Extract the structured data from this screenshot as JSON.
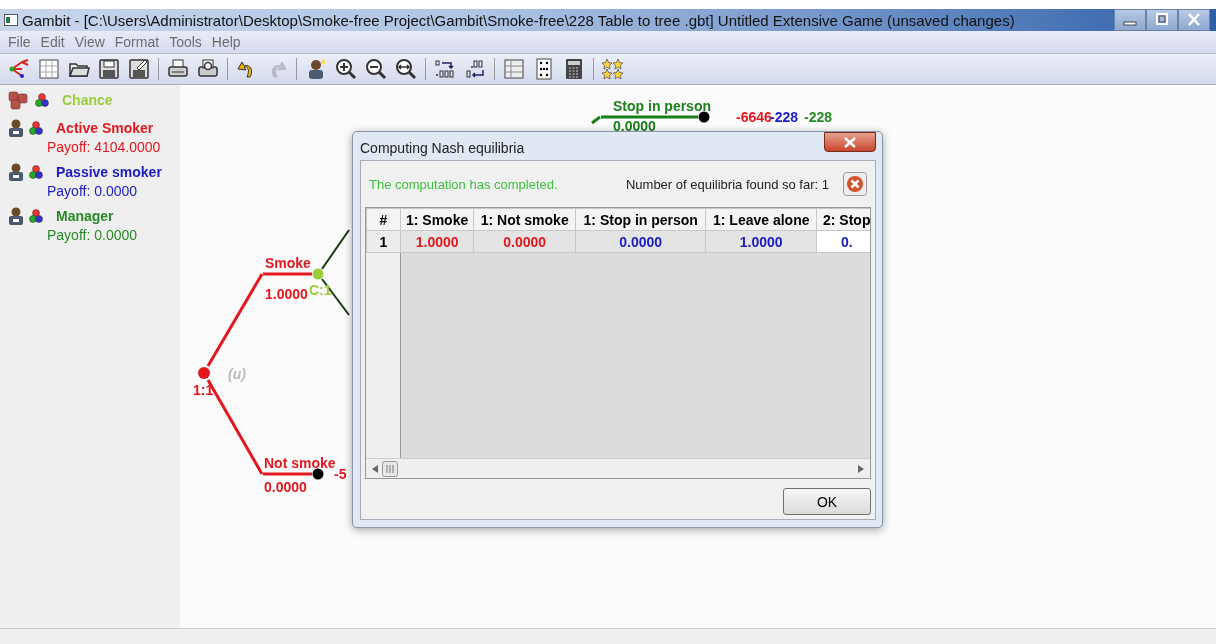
{
  "window": {
    "title": "Gambit - [C:\\Users\\Administrator\\Desktop\\Smoke-free Project\\Gambit\\Smoke-free\\228 Table to tree .gbt] Untitled Extensive Game (unsaved changes)"
  },
  "menu": [
    "File",
    "Edit",
    "View",
    "Format",
    "Tools",
    "Help"
  ],
  "toolbar": [
    [
      {
        "kind": "tree",
        "disabled": false
      },
      {
        "kind": "table",
        "disabled": false
      },
      {
        "kind": "folder",
        "disabled": false
      },
      {
        "kind": "save",
        "disabled": false
      },
      {
        "kind": "saveas",
        "disabled": false
      }
    ],
    [
      {
        "kind": "print",
        "disabled": false
      },
      {
        "kind": "preview",
        "disabled": false
      }
    ],
    [
      {
        "kind": "undo",
        "disabled": false
      },
      {
        "kind": "redo",
        "disabled": true
      }
    ],
    [
      {
        "kind": "person",
        "disabled": false
      },
      {
        "kind": "zoomin",
        "disabled": false
      },
      {
        "kind": "zoomout",
        "disabled": false
      },
      {
        "kind": "zoomfit",
        "disabled": false
      }
    ],
    [
      {
        "kind": "decmore",
        "disabled": false
      },
      {
        "kind": "decless",
        "disabled": false
      }
    ],
    [
      {
        "kind": "grid",
        "disabled": false
      },
      {
        "kind": "dots",
        "disabled": false
      },
      {
        "kind": "calc",
        "disabled": false
      }
    ],
    [
      {
        "kind": "stars",
        "disabled": false
      }
    ]
  ],
  "players": [
    {
      "kind": "chance",
      "name": "Chance",
      "color": "#9acd3c"
    },
    {
      "kind": "person",
      "name": "Active Smoker",
      "payoff": "Payoff: 4104.0000",
      "color": "#e3181f"
    },
    {
      "kind": "person",
      "name": "Passive smoker",
      "payoff": "Payoff: 0.0000",
      "color": "#1c1cc4"
    },
    {
      "kind": "person",
      "name": "Manager",
      "payoff": "Payoff: 0.0000",
      "color": "#278a27"
    }
  ],
  "tree": {
    "nodes": [
      {
        "label": "1:1",
        "info": "(u)",
        "color": "#e3181f"
      },
      {
        "label": "C:1",
        "color": "#9acd3c"
      }
    ],
    "branches": [
      {
        "action": "Smoke",
        "probability": "1.0000",
        "color": "#e3181f"
      },
      {
        "action": "Not smoke",
        "probability": "0.0000",
        "color": "#e3181f"
      },
      {
        "action": "Stop in person",
        "probability": "0.0000",
        "color": "#1a7f1a"
      }
    ],
    "payoffs": [
      {
        "text": "-6646",
        "color": "#e3181f"
      },
      {
        "text": "-228",
        "color": "#1c1cc4"
      },
      {
        "text": "-228",
        "color": "#278a27"
      },
      {
        "text": "-5",
        "color": "#e3181f"
      }
    ]
  },
  "dialog": {
    "title": "Computing Nash equilibria",
    "message": "The computation has completed.",
    "count": "Number of equilibria found so far: 1",
    "columns": [
      {
        "label": "#",
        "color": "#000000"
      },
      {
        "label": "1: Smoke",
        "color": "#e3181f"
      },
      {
        "label": "1: Not smoke",
        "color": "#e3181f"
      },
      {
        "label": "1: Stop in person",
        "color": "#1c1cc4"
      },
      {
        "label": "1: Leave alone",
        "color": "#1c1cc4"
      },
      {
        "label": "2: Stop",
        "color": "#1c1cc4"
      }
    ],
    "rows": [
      [
        {
          "text": "1",
          "selected": false
        },
        {
          "text": "1.0000",
          "selected": false
        },
        {
          "text": "0.0000",
          "selected": false
        },
        {
          "text": "0.0000",
          "selected": false
        },
        {
          "text": "1.0000",
          "selected": false
        },
        {
          "text": "0.",
          "selected": true
        }
      ]
    ],
    "ok": "OK"
  }
}
